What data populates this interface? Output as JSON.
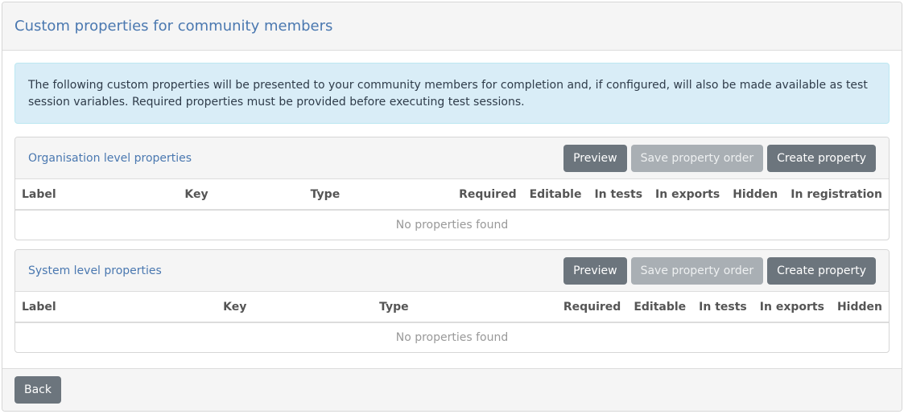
{
  "page": {
    "title": "Custom properties for community members",
    "info": "The following custom properties will be presented to your community members for completion and, if configured, will also be made available as test session variables. Required properties must be provided before executing test sessions.",
    "back_label": "Back"
  },
  "org_panel": {
    "title": "Organisation level properties",
    "preview_label": "Preview",
    "save_order_label": "Save property order",
    "create_label": "Create property",
    "columns": [
      "Label",
      "Key",
      "Type",
      "Required",
      "Editable",
      "In tests",
      "In exports",
      "Hidden",
      "In registration"
    ],
    "empty_text": "No properties found"
  },
  "system_panel": {
    "title": "System level properties",
    "preview_label": "Preview",
    "save_order_label": "Save property order",
    "create_label": "Create property",
    "columns": [
      "Label",
      "Key",
      "Type",
      "Required",
      "Editable",
      "In tests",
      "In exports",
      "Hidden"
    ],
    "empty_text": "No properties found"
  },
  "colors": {
    "accent": "#4a78b0",
    "button": "#6c757d",
    "button_disabled": "#a9afb4",
    "info_bg": "#d9edf7"
  }
}
